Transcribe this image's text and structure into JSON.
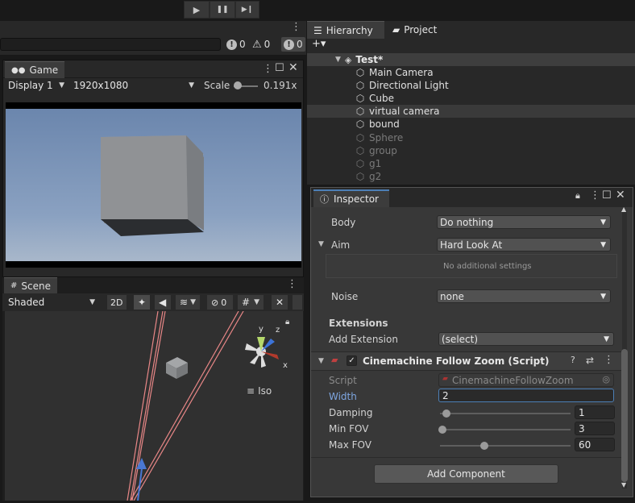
{
  "toolbar": {
    "play": "▶",
    "pause": "❚❚",
    "step": "▶❙"
  },
  "console": {
    "errors": "0",
    "warnings": "0",
    "messages": "0"
  },
  "game": {
    "tab": "Game",
    "display": "Display 1",
    "resolution": "1920x1080",
    "scale_label": "Scale",
    "scale_value": "0.191x"
  },
  "scene": {
    "tab": "Scene",
    "shading": "Shaded",
    "mode_2d": "2D",
    "hidden_count": "0",
    "projection": "Iso",
    "axis_x": "x",
    "axis_y": "y",
    "axis_z": "z"
  },
  "hierarchy": {
    "tab": "Hierarchy",
    "project_tab": "Project",
    "add": "+▾",
    "scene_name": "Test*",
    "items": [
      {
        "label": "Main Camera",
        "active": true
      },
      {
        "label": "Directional Light",
        "active": true
      },
      {
        "label": "Cube",
        "active": true
      },
      {
        "label": "virtual camera",
        "active": true,
        "selected": true
      },
      {
        "label": "bound",
        "active": true
      },
      {
        "label": "Sphere",
        "active": false
      },
      {
        "label": "group",
        "active": false
      },
      {
        "label": "g1",
        "active": false
      },
      {
        "label": "g2",
        "active": false
      }
    ]
  },
  "inspector": {
    "tab": "Inspector",
    "body_label": "Body",
    "body_value": "Do nothing",
    "aim_label": "Aim",
    "aim_value": "Hard Look At",
    "aim_note": "No additional settings",
    "noise_label": "Noise",
    "noise_value": "none",
    "extensions_header": "Extensions",
    "add_extension_label": "Add Extension",
    "add_extension_value": "(select)",
    "component_title": "Cinemachine Follow Zoom (Script)",
    "script_label": "Script",
    "script_value": "CinemachineFollowZoom",
    "width_label": "Width",
    "width_value": "2",
    "damping_label": "Damping",
    "damping_value": "1",
    "damping_fraction": 0.05,
    "minfov_label": "Min FOV",
    "minfov_value": "3",
    "minfov_fraction": 0.02,
    "maxfov_label": "Max FOV",
    "maxfov_value": "60",
    "maxfov_fraction": 0.34,
    "add_component": "Add Component"
  },
  "colors": {
    "accent": "#4c7fb6",
    "selected_row": "#3a3a3a",
    "field": "#515151"
  }
}
